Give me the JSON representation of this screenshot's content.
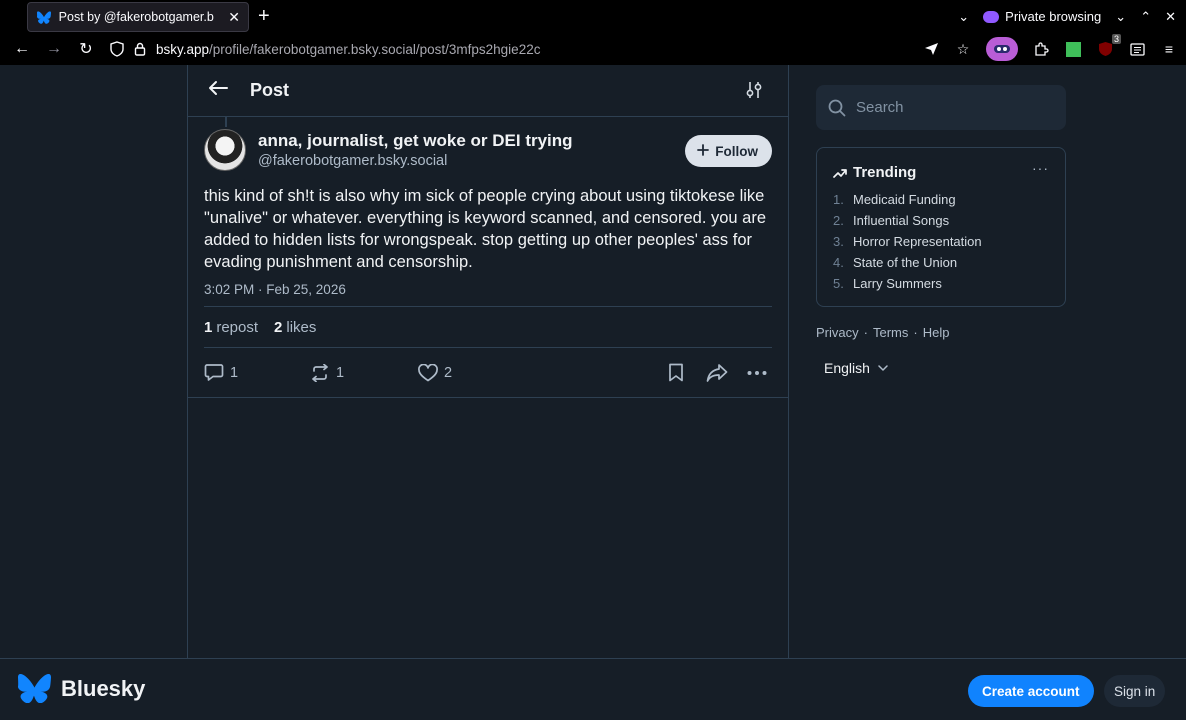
{
  "browser": {
    "tab_title": "Post by @fakerobotgamer.b",
    "new_tab_symbol": "+",
    "private_label": "Private browsing",
    "url_host": "bsky.app",
    "url_path": "/profile/fakerobotgamer.bsky.social/post/3mfps2hgie22c",
    "ublock_badge": "3"
  },
  "header": {
    "title": "Post"
  },
  "post": {
    "display_name": "anna, journalist, get woke or DEI trying",
    "handle": "@fakerobotgamer.bsky.social",
    "follow_label": "Follow",
    "text": "this kind of sh!t is also why im sick of people crying about using tiktokese like \"unalive\" or whatever. everything is keyword scanned, and censored. you are added to hidden lists for wrongspeak. stop getting up other peoples' ass for evading punishment and censorship.",
    "timestamp": "3:02 PM · Feb 25, 2026",
    "reposts_count": "1",
    "reposts_label": "repost",
    "likes_count": "2",
    "likes_label": "likes",
    "reply_count": "1",
    "repost_action_count": "1",
    "like_action_count": "2"
  },
  "sidebar": {
    "search_placeholder": "Search",
    "trending_title": "Trending",
    "trending_more": "···",
    "trending": [
      {
        "num": "1.",
        "label": "Medicaid Funding"
      },
      {
        "num": "2.",
        "label": "Influential Songs"
      },
      {
        "num": "3.",
        "label": "Horror Representation"
      },
      {
        "num": "4.",
        "label": "State of the Union"
      },
      {
        "num": "5.",
        "label": "Larry Summers"
      }
    ],
    "links": {
      "privacy": "Privacy",
      "terms": "Terms",
      "help": "Help",
      "sep": "·"
    },
    "language": "English"
  },
  "bottom": {
    "brand": "Bluesky",
    "create_account": "Create account",
    "sign_in": "Sign in"
  },
  "colors": {
    "background": "#161e27",
    "border": "#2e4052",
    "accent": "#1083fe",
    "muted_text": "#aebbc9"
  }
}
